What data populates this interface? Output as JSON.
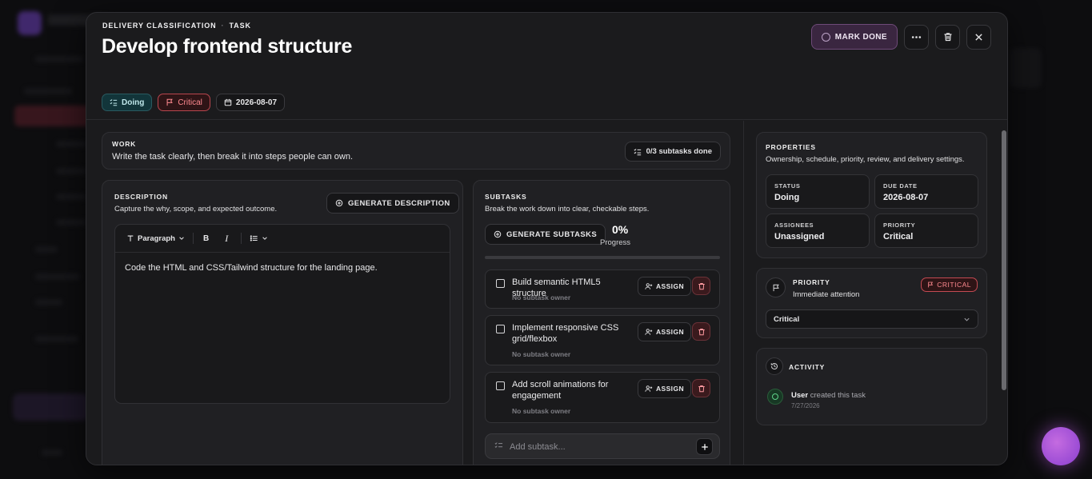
{
  "modal": {
    "breadcrumb": [
      "DELIVERY CLASSIFICATION",
      "TASK"
    ],
    "breadcrumb_sep": "·",
    "title": "Develop frontend structure",
    "mark_done_label": "MARK DONE",
    "tags": {
      "status": "Doing",
      "priority": "Critical",
      "due_date": "2026-08-07"
    }
  },
  "work": {
    "label": "WORK",
    "subtitle": "Write the task clearly, then break it into steps people can own.",
    "subtasks_done": "0/3 subtasks done"
  },
  "description": {
    "label": "DESCRIPTION",
    "subtitle": "Capture the why, scope, and expected outcome.",
    "generate_label": "GENERATE DESCRIPTION",
    "toolbar_paragraph": "Paragraph",
    "bold_glyph": "B",
    "italic_glyph": "I",
    "content": "Code the HTML and CSS/Tailwind structure for the landing page."
  },
  "subtasks": {
    "label": "SUBTASKS",
    "subtitle": "Break the work down into clear, checkable steps.",
    "generate_label": "GENERATE SUBTASKS",
    "progress_pct": "0%",
    "progress_value": 0,
    "progress_label": "Progress",
    "assign_label": "ASSIGN",
    "items": [
      {
        "title": "Build semantic HTML5 structure",
        "owner": "No subtask owner"
      },
      {
        "title": "Implement responsive CSS grid/flexbox",
        "owner": "No subtask owner"
      },
      {
        "title": "Add scroll animations for engagement",
        "owner": "No subtask owner"
      }
    ],
    "add_placeholder": "Add subtask..."
  },
  "properties": {
    "label": "PROPERTIES",
    "subtitle": "Ownership, schedule, priority, review, and delivery settings.",
    "status_label": "STATUS",
    "status_value": "Doing",
    "due_label": "DUE DATE",
    "due_value": "2026-08-07",
    "assignees_label": "ASSIGNEES",
    "assignees_value": "Unassigned",
    "priority_label": "PRIORITY",
    "priority_value": "Critical"
  },
  "priority_panel": {
    "label": "PRIORITY",
    "subtitle": "Immediate attention",
    "badge": "CRITICAL",
    "selected": "Critical"
  },
  "activity": {
    "label": "ACTIVITY",
    "user": "User",
    "action": "created this task",
    "date": "7/27/2026"
  },
  "colors": {
    "accent_purple": "#6e4a78",
    "critical_red": "#c44a52",
    "status_teal": "#2a5a60",
    "activity_green": "#5fd48a"
  }
}
